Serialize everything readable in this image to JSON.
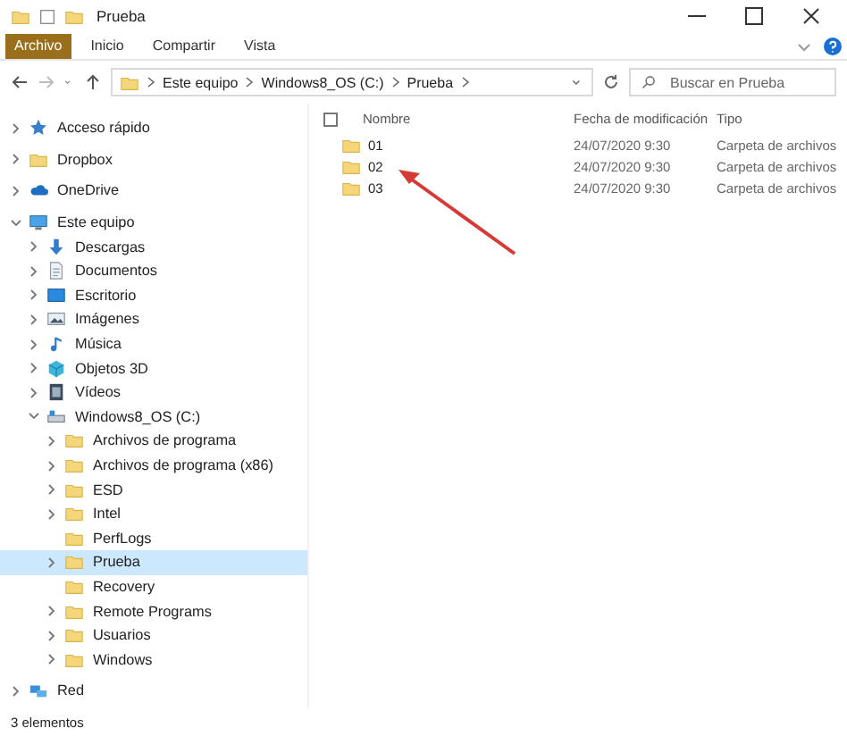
{
  "window": {
    "title": "Prueba"
  },
  "ribbon_tabs": [
    {
      "label": "Archivo",
      "selected": true
    },
    {
      "label": "Inicio",
      "selected": false
    },
    {
      "label": "Compartir",
      "selected": false
    },
    {
      "label": "Vista",
      "selected": false
    }
  ],
  "address_bar": {
    "path": [
      {
        "label": "Este equipo"
      },
      {
        "label": "Windows8_OS (C:)"
      },
      {
        "label": "Prueba"
      }
    ]
  },
  "search": {
    "placeholder": "Buscar en Prueba"
  },
  "sidebar": {
    "items": [
      {
        "label": "Acceso rápido",
        "kind": "star",
        "expanded": false,
        "selected": false
      },
      {
        "label": "Dropbox",
        "kind": "folder",
        "expanded": false,
        "selected": false
      },
      {
        "label": "OneDrive",
        "kind": "cloud",
        "expanded": false,
        "selected": false
      },
      {
        "label": "Este equipo",
        "kind": "pc",
        "expanded": true,
        "selected": false,
        "children": [
          {
            "label": "Descargas",
            "kind": "download",
            "expanded": false,
            "selected": false
          },
          {
            "label": "Documentos",
            "kind": "document",
            "expanded": false,
            "selected": false
          },
          {
            "label": "Escritorio",
            "kind": "desktop",
            "expanded": false,
            "selected": false
          },
          {
            "label": "Imágenes",
            "kind": "image",
            "expanded": false,
            "selected": false
          },
          {
            "label": "Música",
            "kind": "music",
            "expanded": false,
            "selected": false
          },
          {
            "label": "Objetos 3D",
            "kind": "cube",
            "expanded": false,
            "selected": false
          },
          {
            "label": "Vídeos",
            "kind": "film",
            "expanded": false,
            "selected": false
          },
          {
            "label": "Windows8_OS (C:)",
            "kind": "drive",
            "expanded": true,
            "selected": false,
            "children": [
              {
                "label": "Archivos de programa",
                "kind": "folder",
                "expanded": false,
                "selected": false
              },
              {
                "label": "Archivos de programa (x86)",
                "kind": "folder",
                "expanded": false,
                "selected": false
              },
              {
                "label": "ESD",
                "kind": "folder",
                "expanded": false,
                "selected": false
              },
              {
                "label": "Intel",
                "kind": "folder",
                "expanded": false,
                "selected": false
              },
              {
                "label": "PerfLogs",
                "kind": "folder",
                "selected": false
              },
              {
                "label": "Prueba",
                "kind": "folder",
                "expanded": false,
                "selected": true
              },
              {
                "label": "Recovery",
                "kind": "folder",
                "selected": false
              },
              {
                "label": "Remote Programs",
                "kind": "folder",
                "expanded": false,
                "selected": false
              },
              {
                "label": "Usuarios",
                "kind": "folder",
                "expanded": false,
                "selected": false
              },
              {
                "label": "Windows",
                "kind": "folder",
                "expanded": false,
                "selected": false
              }
            ]
          }
        ]
      },
      {
        "label": "Red",
        "kind": "network",
        "expanded": false,
        "selected": false
      }
    ]
  },
  "file_list": {
    "select_all": {
      "checked": false
    },
    "columns": [
      "Nombre",
      "Fecha de modificación",
      "Tipo"
    ],
    "rows": [
      {
        "name": "01",
        "modified": "24/07/2020 9:30",
        "type": "Carpeta de archivos"
      },
      {
        "name": "02",
        "modified": "24/07/2020 9:30",
        "type": "Carpeta de archivos"
      },
      {
        "name": "03",
        "modified": "24/07/2020 9:30",
        "type": "Carpeta de archivos"
      }
    ]
  },
  "annotation": {
    "kind": "arrow",
    "color": "#d63a36"
  },
  "status_bar": {
    "text": "3 elementos"
  }
}
